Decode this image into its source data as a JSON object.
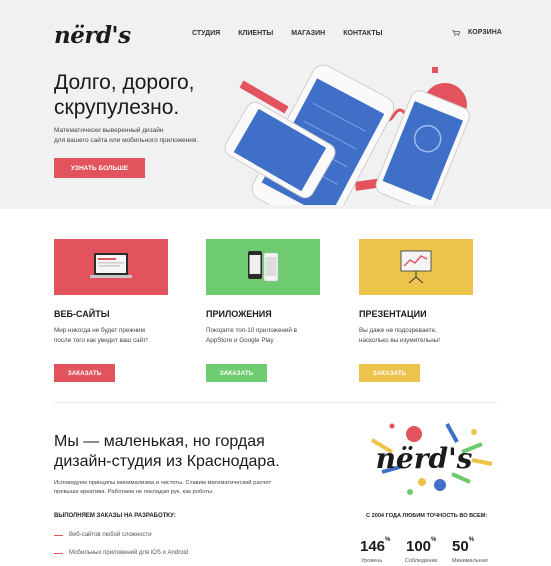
{
  "brand": {
    "logo_text": "nërd's"
  },
  "nav": {
    "items": [
      "СТУДИЯ",
      "КЛИЕНТЫ",
      "МАГАЗИН",
      "КОНТАКТЫ"
    ],
    "cart_label": "КОРЗИНА"
  },
  "hero": {
    "title_line1": "Долго, дорого,",
    "title_line2": "скрупулезно.",
    "subtitle_line1": "Математически выверенный дизайн",
    "subtitle_line2": "для вашего сайта или мобильного приложения.",
    "cta_label": "УЗНАТЬ БОЛЬШЕ"
  },
  "services": [
    {
      "title": "ВЕБ-САЙТЫ",
      "text_line1": "Мир никогда не будет прежним",
      "text_line2": "после того как увидит ваш сайт!",
      "button": "ЗАКАЗАТЬ",
      "color": "#e2535d",
      "icon": "laptop-icon"
    },
    {
      "title": "ПРИЛОЖЕНИЯ",
      "text_line1": "Покорите топ-10 приложений в",
      "text_line2": "AppStore и Google Play",
      "button": "ЗАКАЗАТЬ",
      "color": "#6ecb6f",
      "icon": "phones-icon"
    },
    {
      "title": "ПРЕЗЕНТАЦИИ",
      "text_line1": "Вы даже не подозреваете,",
      "text_line2": "насколько вы изумительны!",
      "button": "ЗАКАЗАТЬ",
      "color": "#ecc44b",
      "icon": "presentation-board-icon"
    }
  ],
  "about": {
    "title_line1": "Мы — маленькая, но гордая",
    "title_line2": "дизайн-студия из Краснодара.",
    "text_line1": "Исповедуем принципы минимализма и чистоты. Ставим математический расчет",
    "text_line2": "превыше креатива. Работаем не покладая рук, как роботы.",
    "orders_heading": "ВЫПОЛНЯЕМ ЗАКАЗЫ НА РАЗРАБОТКУ:",
    "orders": [
      "Веб-сайтов любой сложности",
      "Мобильных приложений для iOS и Android"
    ]
  },
  "stats": {
    "heading": "С 2004 ГОДА ЛЮБИМ ТОЧНОСТЬ ВО ВСЕМ:",
    "items": [
      {
        "value": "146",
        "unit": "%",
        "label": "Уровень"
      },
      {
        "value": "100",
        "unit": "%",
        "label": "Соблюдение"
      },
      {
        "value": "50",
        "unit": "%",
        "label": "Минимальная"
      }
    ]
  },
  "colors": {
    "red": "#e2535d",
    "green": "#6ecb6f",
    "yellow": "#ecc44b",
    "blue": "#3f6fc7"
  }
}
